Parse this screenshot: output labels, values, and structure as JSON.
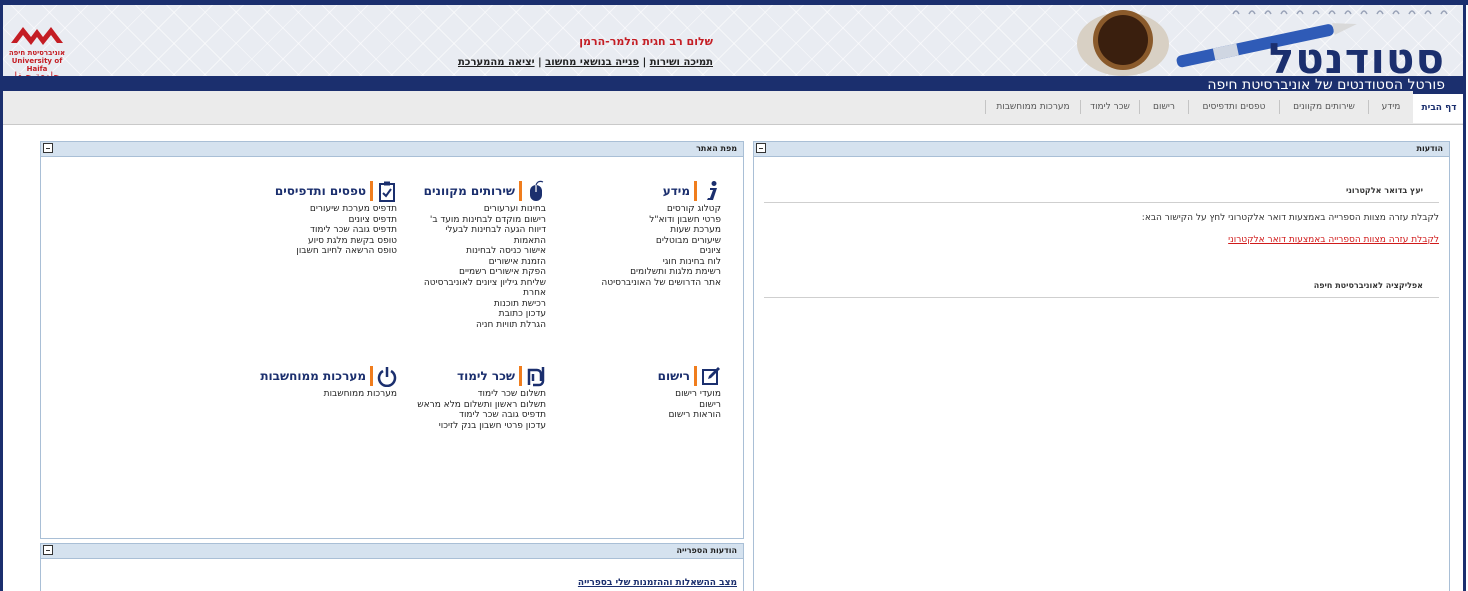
{
  "header": {
    "logo_text_he": "אוניברסיטת חיפה",
    "logo_text_en": "University of Haifa",
    "logo_text_ar": "جامعة حيفا",
    "welcome": "שלום רב חגית הלמר-הרמן",
    "links": [
      "תמיכה ושירות",
      "פנייה בנושאי מחשוב",
      "יציאה מהמערכת"
    ],
    "brand": "סטודנטל",
    "subtitle": "פורטל הסטודנטים של אוניברסיטת חיפה"
  },
  "nav": {
    "tabs": [
      "דף הבית",
      "מידע",
      "שירותים מקוונים",
      "טפסים ותדפיסים",
      "רישום",
      "שכר לימוד",
      "מערכות ממוחשבות"
    ],
    "active_index": 0
  },
  "announcements": {
    "title": "הודעות",
    "email_heading": "יעץ בדואר אלקטרוני",
    "email_text": "לקבלת עזרה מצוות הספרייה באמצעות דואר אלקטרוני לחץ על הקישור הבא:",
    "email_link": "לקבלת עזרה מצוות הספרייה באמצעות דואר אלקטרוני",
    "app_heading": "אפליקציה לאוניברסיטת חיפה"
  },
  "sitemap": {
    "title": "מפת האתר",
    "sections": [
      {
        "title": "מידע",
        "icon": "info-icon",
        "items": [
          "קטלוג קורסים",
          "פרטי חשבון ודוא\"ל",
          "מערכת שעות",
          "שיעורים מבוטלים",
          "ציונים",
          "לוח בחינות חוגי",
          "רשימת מלגות ותשלומים",
          "אתר הדרושים של האוניברסיטה"
        ]
      },
      {
        "title": "שירותים מקוונים",
        "icon": "mouse-icon",
        "items": [
          "בחינות וערעורים",
          "רישום מוקדם לבחינות מועד ב'",
          "דיווח הגעה לבחינות לבעלי",
          "התאמות",
          "אישור כניסה לבחינות",
          "הזמנת אישורים",
          "הפקת אישורים רשמיים",
          "שליחת גיליון ציונים לאוניברסיטה",
          "אחרת",
          "רכישת תוכנות",
          "עדכון כתובת",
          "הגרלת תוויות חניה"
        ]
      },
      {
        "title": "טפסים ותדפיסים",
        "icon": "clipboard-icon",
        "items": [
          "תדפיס מערכת שיעורים",
          "תדפיס ציונים",
          "תדפיס גובה שכר לימוד",
          "טופס בקשת מלגת סיוע",
          "טופס הרשאה לחיוב חשבון"
        ]
      },
      {
        "title": "רישום",
        "icon": "edit-icon",
        "items": [
          "מועדי רישום",
          "רישום",
          "הוראות רישום"
        ]
      },
      {
        "title": "שכר לימוד",
        "icon": "shekel-icon",
        "items": [
          "תשלום שכר לימוד",
          "תשלום ראשון ותשלום מלא מראש",
          "תדפיס גובה שכר לימוד",
          "עדכון פרטי חשבון בנק לזיכוי"
        ]
      },
      {
        "title": "מערכות ממוחשבות",
        "icon": "power-icon",
        "items": [
          "מערכות ממוחשבות"
        ]
      }
    ]
  },
  "library": {
    "title": "הודעות הספרייה",
    "link": "מצב ההשאלות וההזמנות שלי בספרייה"
  },
  "colors": {
    "navy": "#1b2f6e",
    "accent": "#f07d1d",
    "red": "#c41d24",
    "panel_head": "#d5e2ef"
  }
}
